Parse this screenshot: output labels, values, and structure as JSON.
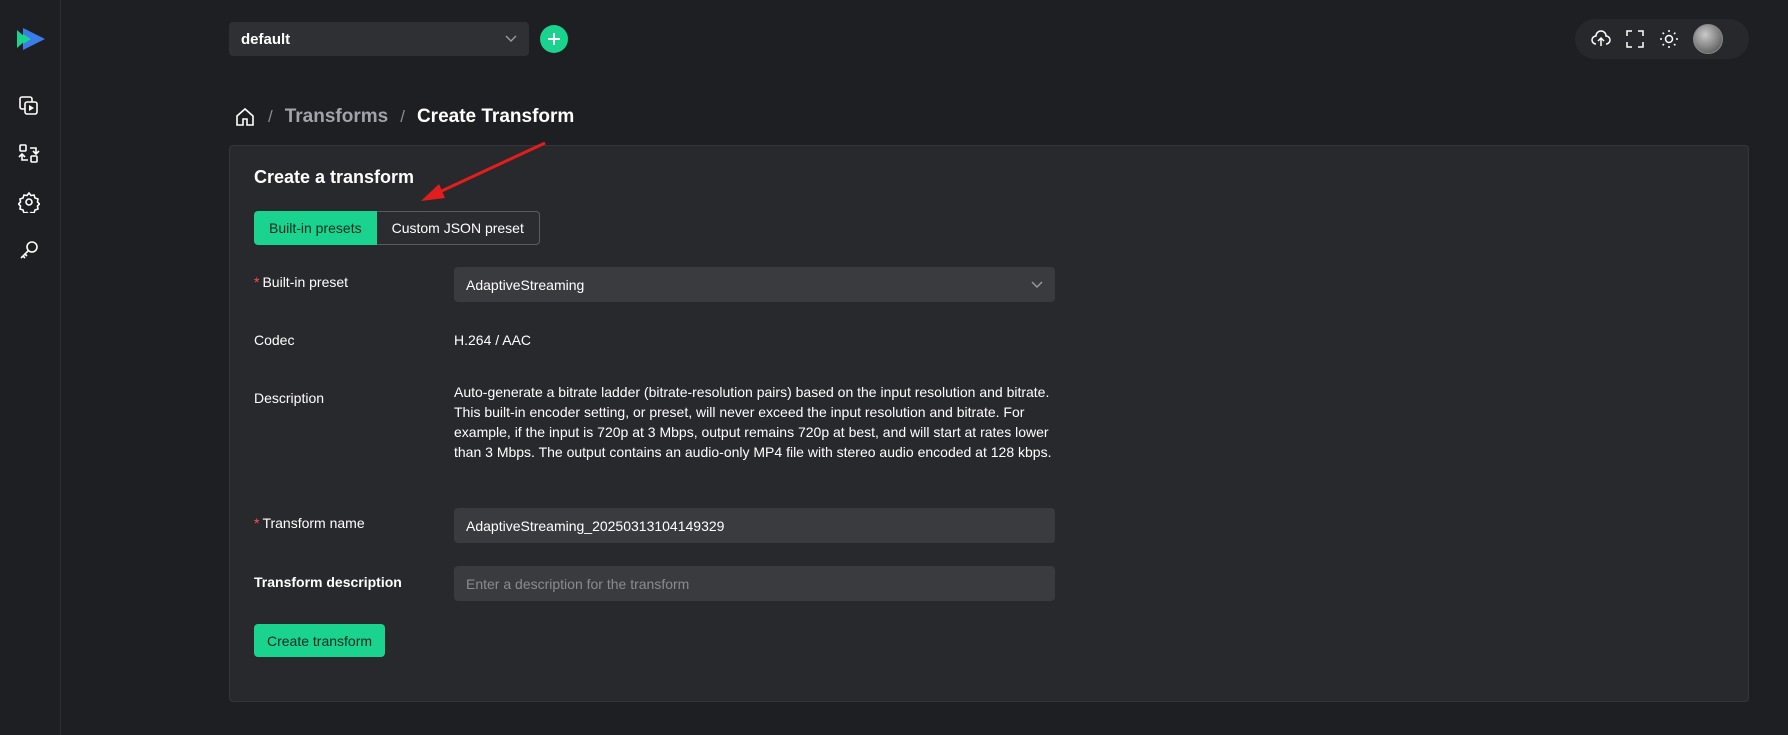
{
  "colors": {
    "accent": "#19d38f",
    "background": "#1e1f22",
    "card": "#28292d",
    "annotation_arrow": "#e11d1d"
  },
  "sidebar": {
    "logo": "logo-play-icon",
    "items": [
      {
        "icon": "media-library-icon"
      },
      {
        "icon": "transforms-icon"
      },
      {
        "icon": "settings-gear-icon"
      },
      {
        "icon": "key-icon"
      }
    ]
  },
  "topbar": {
    "account_select": {
      "value": "default"
    },
    "right_icons": [
      "upload-cloud-icon",
      "fullscreen-icon",
      "theme-sun-icon",
      "avatar"
    ]
  },
  "breadcrumb": {
    "link": "Transforms",
    "current": "Create Transform"
  },
  "form": {
    "title": "Create a transform",
    "tabs": {
      "active": "Built-in presets",
      "inactive": "Custom JSON preset"
    },
    "preset": {
      "label": "Built-in preset",
      "value": "AdaptiveStreaming"
    },
    "codec": {
      "label": "Codec",
      "value": "H.264 / AAC"
    },
    "description": {
      "label": "Description",
      "value": "Auto-generate a bitrate ladder (bitrate-resolution pairs) based on the input resolution and bitrate. This built-in encoder setting, or preset, will never exceed the input resolution and bitrate. For example, if the input is 720p at 3 Mbps, output remains 720p at best, and will start at rates lower than 3 Mbps. The output contains an audio-only MP4 file with stereo audio encoded at 128 kbps."
    },
    "transform_name": {
      "label": "Transform name",
      "value": "AdaptiveStreaming_20250313104149329"
    },
    "transform_description": {
      "label": "Transform description",
      "placeholder": "Enter a description for the transform"
    },
    "submit_label": "Create transform"
  }
}
